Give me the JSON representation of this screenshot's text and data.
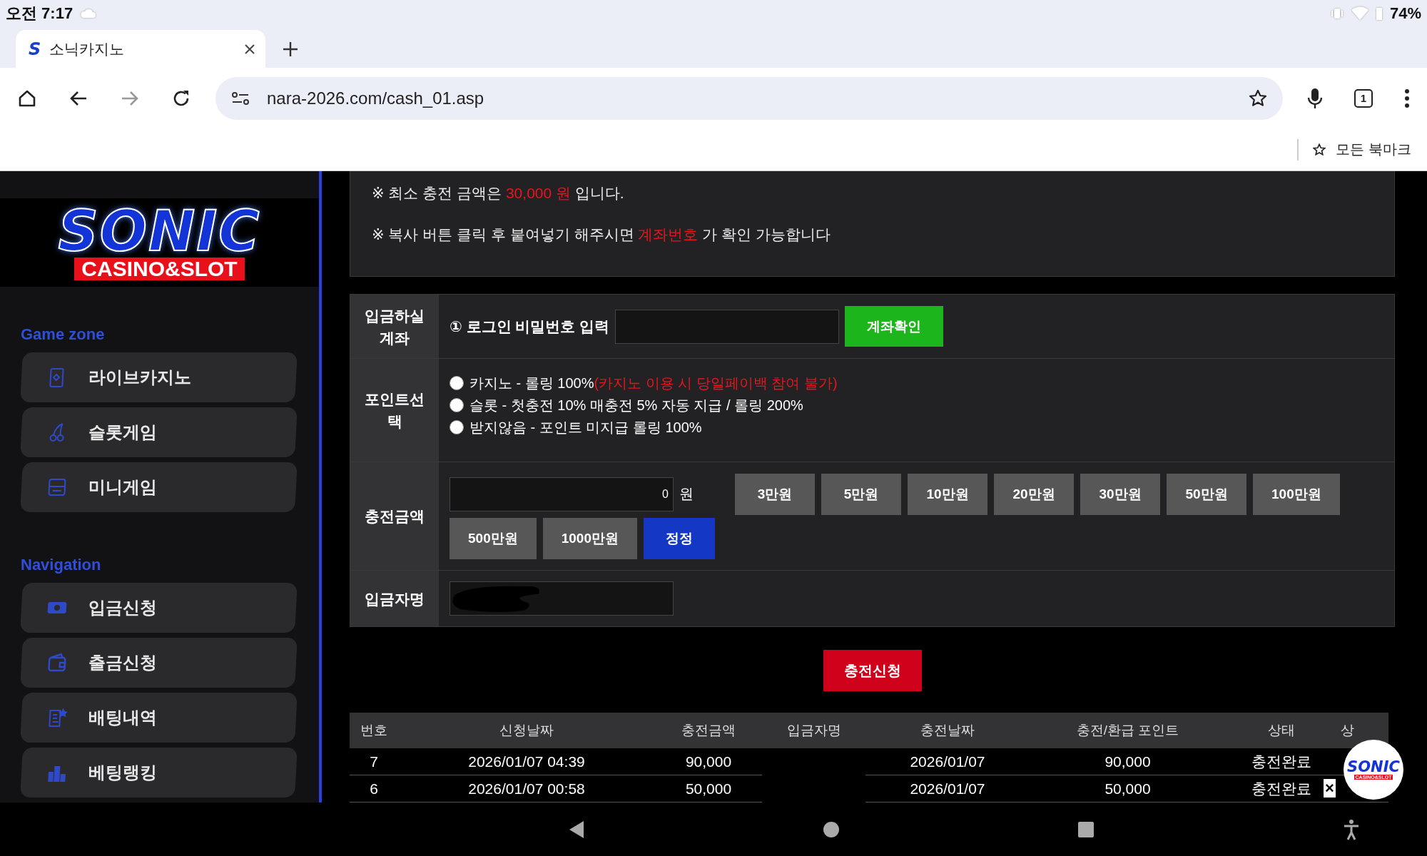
{
  "status_bar": {
    "time": "오전 7:17",
    "battery": "74%"
  },
  "browser": {
    "tab": {
      "title": "소닉카지노",
      "favicon": "S"
    },
    "url": "nara-2026.com/cash_01.asp",
    "tab_count": "1",
    "bookmarks": "모든 북마크"
  },
  "sidebar": {
    "logo": {
      "title": "SONIC",
      "subtitle": "CASINO&SLOT"
    },
    "sections": [
      {
        "title": "Game zone",
        "items": [
          {
            "label": "라이브카지노",
            "kind": "cards"
          },
          {
            "label": "슬롯게임",
            "kind": "cherry"
          },
          {
            "label": "미니게임",
            "kind": "panel"
          }
        ]
      },
      {
        "title": "Navigation",
        "items": [
          {
            "label": "입금신청",
            "kind": "cash"
          },
          {
            "label": "출금신청",
            "kind": "wallet"
          },
          {
            "label": "배팅내역",
            "kind": "list"
          },
          {
            "label": "베팅랭킹",
            "kind": "podium"
          }
        ]
      }
    ]
  },
  "notices": [
    [
      {
        "text": "※ 최소 충전 금액은 ",
        "highlight": false
      },
      {
        "text": "30,000 원",
        "highlight": true
      },
      {
        "text": " 입니다.",
        "highlight": false
      }
    ],
    [
      {
        "text": "※ 복사 버튼 클릭 후 붙여넣기 해주시면 ",
        "highlight": false
      },
      {
        "text": "계좌번호",
        "highlight": true
      },
      {
        "text": " 가 확인 가능합니다",
        "highlight": false
      }
    ]
  ],
  "form": [
    {
      "kind": "account",
      "label": "입금하실 계좌",
      "prompt": "① 로그인 비밀번호 입력",
      "button": "계좌확인"
    },
    {
      "kind": "points",
      "label": "포인트선택",
      "options": [
        {
          "text": "카지노 - 롤링 100%",
          "note": "(카지노 이용 시 당일페이백 참여 불가)",
          "selected": false
        },
        {
          "text": "슬롯 - 첫충전 10% 매충전 5% 자동 지급 / 롤링 200%",
          "selected": false
        },
        {
          "text": "받지않음 - 포인트 미지급 롤링 100%",
          "selected": false
        }
      ]
    },
    {
      "kind": "amount",
      "label": "충전금액",
      "value": "0",
      "unit": "원",
      "presets": [
        "3만원",
        "5만원",
        "10만원",
        "20만원",
        "30만원",
        "50만원",
        "100만원",
        "500만원",
        "1000만원"
      ],
      "reset": "정정"
    },
    {
      "kind": "name",
      "label": "입금자명",
      "redacted": true
    }
  ],
  "submit": "충전신청",
  "table": {
    "columns": [
      "번호",
      "신청날짜",
      "충전금액",
      "입금자명",
      "충전날짜",
      "충전/환급 포인트",
      "상태",
      "상"
    ],
    "rows": [
      [
        "7",
        "2026/01/07 04:39",
        "90,000",
        "",
        "2026/01/07",
        "90,000",
        "충전완료",
        ""
      ],
      [
        "6",
        "2026/01/07 00:58",
        "50,000",
        "",
        "2026/01/07",
        "50,000",
        "충전완료",
        ""
      ]
    ]
  },
  "floating_badge": {
    "title": "SONIC",
    "subtitle": "CASINO&SLOT",
    "close": "×"
  }
}
